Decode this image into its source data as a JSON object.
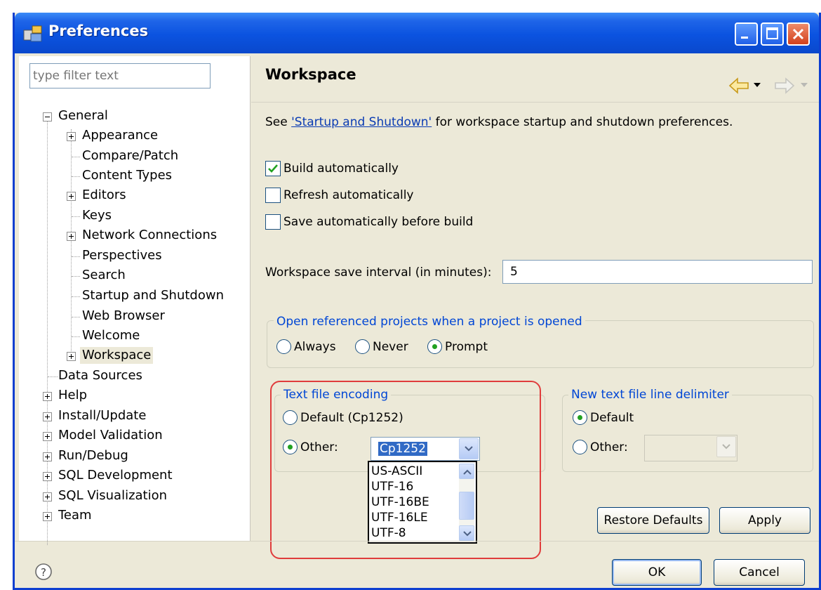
{
  "window": {
    "title": "Preferences"
  },
  "filter": {
    "placeholder": "type filter text"
  },
  "tree": {
    "general": "General",
    "appearance": "Appearance",
    "compare": "Compare/Patch",
    "content_types": "Content Types",
    "editors": "Editors",
    "keys": "Keys",
    "network": "Network Connections",
    "perspectives": "Perspectives",
    "search": "Search",
    "startup": "Startup and Shutdown",
    "web_browser": "Web Browser",
    "welcome": "Welcome",
    "workspace": "Workspace",
    "data_sources": "Data Sources",
    "help": "Help",
    "install": "Install/Update",
    "model_validation": "Model Validation",
    "run_debug": "Run/Debug",
    "sql_dev": "SQL Development",
    "sql_vis": "SQL Visualization",
    "team": "Team"
  },
  "page": {
    "title": "Workspace",
    "desc_prefix": "See ",
    "desc_link": "'Startup and Shutdown'",
    "desc_suffix": " for workspace startup and shutdown preferences."
  },
  "checkboxes": {
    "build": "Build automatically",
    "build_checked": true,
    "refresh": "Refresh automatically",
    "refresh_checked": false,
    "save": "Save automatically before build",
    "save_checked": false
  },
  "interval": {
    "label": "Workspace save interval (in minutes):",
    "value": "5"
  },
  "open_projects": {
    "title": "Open referenced projects when a project is opened",
    "always": "Always",
    "never": "Never",
    "prompt": "Prompt",
    "selected": "Prompt"
  },
  "encoding": {
    "title": "Text file encoding",
    "default": "Default (Cp1252)",
    "other": "Other:",
    "selected": "Other",
    "value": "Cp1252",
    "options": [
      "US-ASCII",
      "UTF-16",
      "UTF-16BE",
      "UTF-16LE",
      "UTF-8"
    ]
  },
  "line_delimiter": {
    "title": "New text file line delimiter",
    "default": "Default",
    "other": "Other:",
    "selected": "Default",
    "value": ""
  },
  "buttons": {
    "restore": "Restore Defaults",
    "apply": "Apply",
    "ok": "OK",
    "cancel": "Cancel"
  },
  "colors": {
    "title_bar": "#0b53e0",
    "link": "#0a3bb3",
    "group_title": "#0046d5",
    "highlight": "#e03c3c"
  }
}
